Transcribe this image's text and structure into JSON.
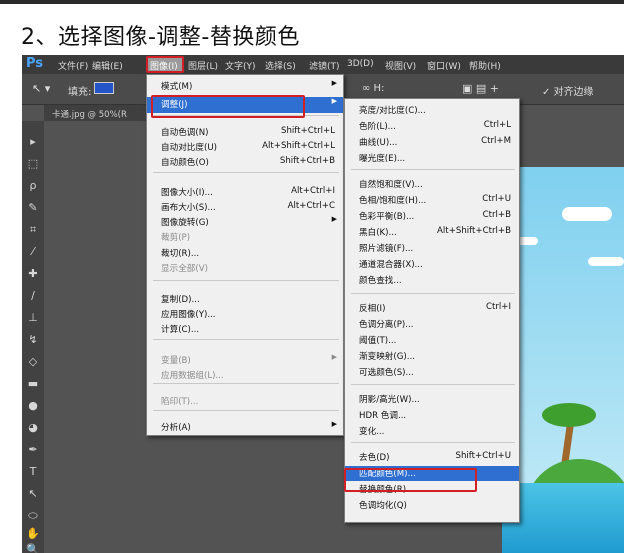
{
  "heading": "2、选择图像-调整-替换颜色",
  "app_logo": "Ps",
  "menubar": [
    "文件(F)",
    "编辑(E)",
    "图像(I)",
    "图层(L)",
    "文字(Y)",
    "选择(S)",
    "滤镜(T)",
    "3D(D)",
    "视图(V)",
    "窗口(W)",
    "帮助(H)"
  ],
  "options": {
    "fill_label": "填充:",
    "align_label": "对齐边缘",
    "extra1": "∞ H:"
  },
  "document_tab": "卡通.jpg @ 50%(R",
  "image_menu": {
    "items": [
      {
        "label": "模式(M)",
        "shortcut": "",
        "submenu": true
      },
      {
        "label": "调整(J)",
        "shortcut": "",
        "submenu": true
      },
      {
        "label": "自动色调(N)",
        "shortcut": "Shift+Ctrl+L"
      },
      {
        "label": "自动对比度(U)",
        "shortcut": "Alt+Shift+Ctrl+L"
      },
      {
        "label": "自动颜色(O)",
        "shortcut": "Shift+Ctrl+B"
      },
      {
        "label": "图像大小(I)...",
        "shortcut": "Alt+Ctrl+I"
      },
      {
        "label": "画布大小(S)...",
        "shortcut": "Alt+Ctrl+C"
      },
      {
        "label": "图像旋转(G)",
        "shortcut": "",
        "submenu": true
      },
      {
        "label": "裁剪(P)",
        "shortcut": "",
        "disabled": true
      },
      {
        "label": "裁切(R)...",
        "shortcut": ""
      },
      {
        "label": "显示全部(V)",
        "shortcut": "",
        "disabled": true
      },
      {
        "label": "复制(D)...",
        "shortcut": ""
      },
      {
        "label": "应用图像(Y)...",
        "shortcut": ""
      },
      {
        "label": "计算(C)...",
        "shortcut": ""
      },
      {
        "label": "变量(B)",
        "shortcut": "",
        "submenu": true,
        "disabled": true
      },
      {
        "label": "应用数据组(L)...",
        "shortcut": "",
        "disabled": true
      },
      {
        "label": "陷印(T)...",
        "shortcut": "",
        "disabled": true
      },
      {
        "label": "分析(A)",
        "shortcut": "",
        "submenu": true
      }
    ]
  },
  "adjust_menu": {
    "items": [
      {
        "label": "亮度/对比度(C)...",
        "shortcut": ""
      },
      {
        "label": "色阶(L)...",
        "shortcut": "Ctrl+L"
      },
      {
        "label": "曲线(U)...",
        "shortcut": "Ctrl+M"
      },
      {
        "label": "曝光度(E)...",
        "shortcut": ""
      },
      {
        "label": "自然饱和度(V)...",
        "shortcut": ""
      },
      {
        "label": "色相/饱和度(H)...",
        "shortcut": "Ctrl+U"
      },
      {
        "label": "色彩平衡(B)...",
        "shortcut": "Ctrl+B"
      },
      {
        "label": "黑白(K)...",
        "shortcut": "Alt+Shift+Ctrl+B"
      },
      {
        "label": "照片滤镜(F)...",
        "shortcut": ""
      },
      {
        "label": "通道混合器(X)...",
        "shortcut": ""
      },
      {
        "label": "颜色查找...",
        "shortcut": ""
      },
      {
        "label": "反相(I)",
        "shortcut": "Ctrl+I"
      },
      {
        "label": "色调分离(P)...",
        "shortcut": ""
      },
      {
        "label": "阈值(T)...",
        "shortcut": ""
      },
      {
        "label": "渐变映射(G)...",
        "shortcut": ""
      },
      {
        "label": "可选颜色(S)...",
        "shortcut": ""
      },
      {
        "label": "阴影/高光(W)...",
        "shortcut": ""
      },
      {
        "label": "HDR 色调...",
        "shortcut": ""
      },
      {
        "label": "变化...",
        "shortcut": ""
      },
      {
        "label": "去色(D)",
        "shortcut": "Shift+Ctrl+U"
      },
      {
        "label": "匹配颜色(M)...",
        "shortcut": ""
      },
      {
        "label": "替换颜色(R)...",
        "shortcut": ""
      },
      {
        "label": "色调均化(Q)",
        "shortcut": ""
      }
    ]
  },
  "colors": {
    "accent": "#2f6fd1",
    "highlight_box": "#d21f26"
  }
}
